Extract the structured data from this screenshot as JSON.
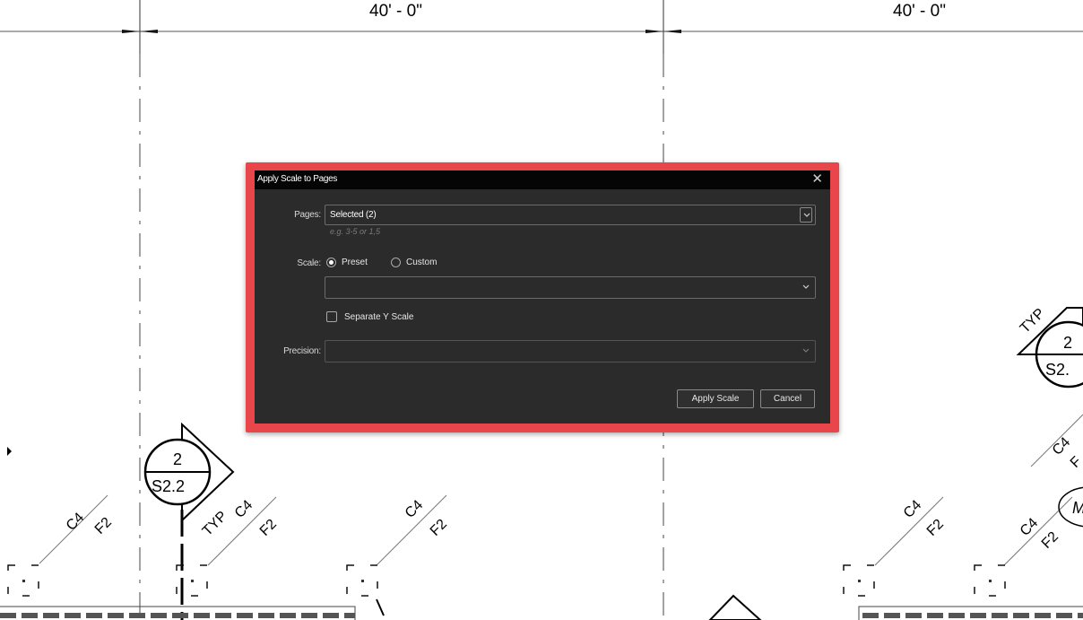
{
  "drawing": {
    "dimension_labels": [
      "40' - 0\"",
      "40' - 0\""
    ],
    "section_markers": [
      {
        "number": "2",
        "sheet": "S2.2"
      },
      {
        "number": "2",
        "sheet": "S2."
      }
    ],
    "typ_labels": [
      "TYP",
      "TYP"
    ],
    "member_tags": [
      {
        "top": "C4",
        "bottom": "F2"
      },
      {
        "top": "C4",
        "bottom": "F2"
      },
      {
        "top": "C4",
        "bottom": "F2"
      },
      {
        "top": "C4",
        "bottom": "F2"
      },
      {
        "top": "C4",
        "bottom": "F2"
      },
      {
        "top": "C4",
        "bottom": "F"
      }
    ],
    "partial_oval_label": "M"
  },
  "dialog": {
    "title": "Apply Scale to Pages",
    "close_icon": "close-icon",
    "pages_label": "Pages:",
    "pages_value": "Selected (2)",
    "pages_hint": "e.g. 3-5 or 1,5",
    "scale_label": "Scale:",
    "scale_options": [
      {
        "label": "Preset",
        "selected": true
      },
      {
        "label": "Custom",
        "selected": false
      }
    ],
    "preset_value": "",
    "separate_y_label": "Separate Y Scale",
    "separate_y_checked": false,
    "precision_label": "Precision:",
    "precision_value": "",
    "apply_label": "Apply Scale",
    "cancel_label": "Cancel"
  },
  "colors": {
    "highlight": "#e8464a",
    "dialog_bg": "#2b2b2b",
    "titlebar_bg": "#050505"
  }
}
